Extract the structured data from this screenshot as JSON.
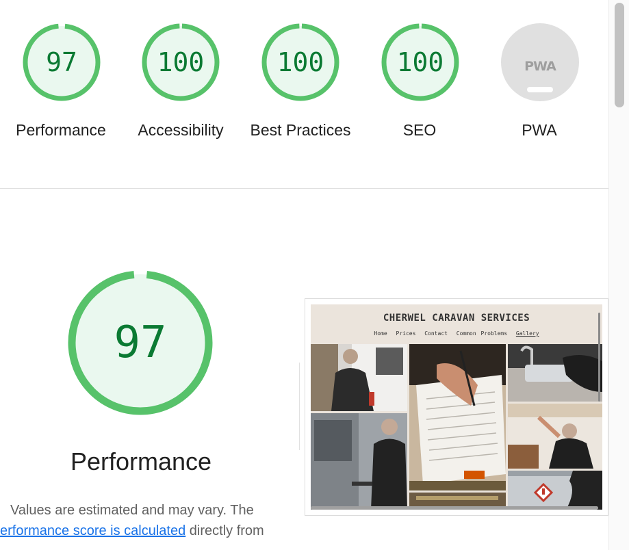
{
  "categories": [
    {
      "id": "performance",
      "score": "97",
      "label": "Performance",
      "value": 0.97
    },
    {
      "id": "accessibility",
      "score": "100",
      "label": "Accessibility",
      "value": 1.0
    },
    {
      "id": "best-practices",
      "score": "100",
      "label": "Best Practices",
      "value": 1.0
    },
    {
      "id": "seo",
      "score": "100",
      "label": "SEO",
      "value": 1.0
    }
  ],
  "pwa": {
    "badge": "PWA",
    "label": "PWA"
  },
  "main": {
    "score": "97",
    "score_value": 0.97,
    "title": "Performance",
    "desc_line1": "Values are estimated and may vary. The",
    "desc_link": "erformance score is calculated",
    "desc_after_link": " directly from"
  },
  "thumbnail": {
    "site_title": "CHERWEL CARAVAN SERVICES",
    "nav": [
      "Home",
      "Prices",
      "Contact",
      "Common Problems",
      "Gallery"
    ],
    "active_nav": "Gallery"
  },
  "colors": {
    "pass": "#0cce6b",
    "pass_fill": "#e8f8ee",
    "pass_text": "#0b7a33",
    "na": "#e0e0e0",
    "link": "#1a73e8"
  }
}
